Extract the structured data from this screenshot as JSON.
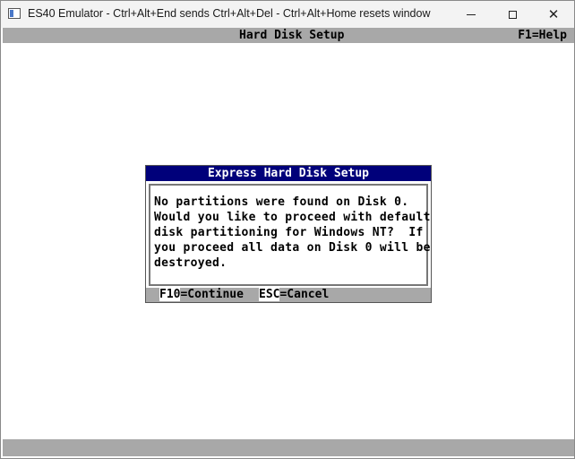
{
  "window": {
    "title": "ES40 Emulator - Ctrl+Alt+End sends Ctrl+Alt+Del - Ctrl+Alt+Home resets window",
    "controls": {
      "minimize": "minimize-icon",
      "maximize": "maximize-icon",
      "close": "close-icon"
    },
    "close_symbol": "✕"
  },
  "setup": {
    "header_title": "Hard Disk Setup",
    "help_hint": "F1=Help"
  },
  "dialog": {
    "title": "Express Hard Disk Setup",
    "message_lines": [
      "No partitions were found on Disk 0.",
      "Would you like to proceed with default",
      "disk partitioning for Windows NT?  If",
      "you proceed all data on Disk 0 will be",
      "destroyed."
    ],
    "footer": {
      "continue_key": "F10",
      "continue_label": "=Continue",
      "cancel_key": "ESC",
      "cancel_label": "=Cancel"
    }
  },
  "colors": {
    "dialog_title_bg": "#00007a",
    "status_bar_bg": "#a8a8a8"
  }
}
